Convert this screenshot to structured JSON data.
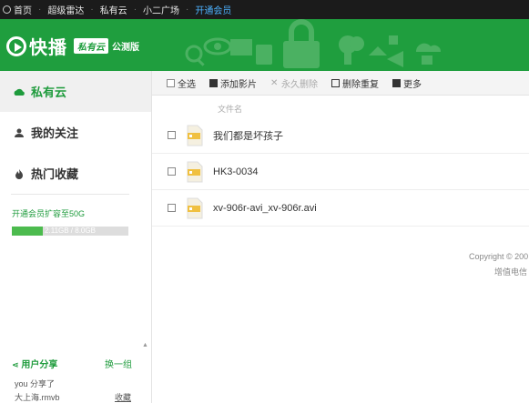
{
  "top_nav": {
    "items": [
      {
        "label": "首页",
        "active": false
      },
      {
        "label": "超级雷达",
        "active": false
      },
      {
        "label": "私有云",
        "active": false
      },
      {
        "label": "小二广场",
        "active": false
      },
      {
        "label": "开通会员",
        "active": true
      }
    ]
  },
  "banner": {
    "brand": "快播",
    "badge": "私有云",
    "beta": "公测版"
  },
  "sidebar": {
    "items": [
      {
        "label": "私有云",
        "icon": "cloud-icon",
        "active": true
      },
      {
        "label": "我的关注",
        "icon": "user-follow-icon",
        "active": false
      },
      {
        "label": "热门收藏",
        "icon": "flame-icon",
        "active": false
      }
    ],
    "quota_link": "开通会员扩容至50G",
    "quota_text": "2.11GB / 8.0GB",
    "quota_used_fraction": 0.264,
    "share": {
      "title": "用户分享",
      "switch": "换一组",
      "line1": "you  分享了",
      "file": "大上海.rmvb",
      "collect": "收藏"
    }
  },
  "toolbar": {
    "select_all": "全选",
    "add_video": "添加影片",
    "delete_forever": "永久删除",
    "delete_dup": "删除重复",
    "more": "更多"
  },
  "file_list": {
    "column_header": "文件名",
    "files": [
      {
        "name": "我们都是坏孩子"
      },
      {
        "name": "HK3-0034"
      },
      {
        "name": "xv-906r-avi_xv-906r.avi"
      }
    ]
  },
  "footer": {
    "copyright": "Copyright © 200",
    "license": "增值电信"
  },
  "colors": {
    "brand_green": "#1f9e3e",
    "link_blue": "#4db2ff"
  }
}
